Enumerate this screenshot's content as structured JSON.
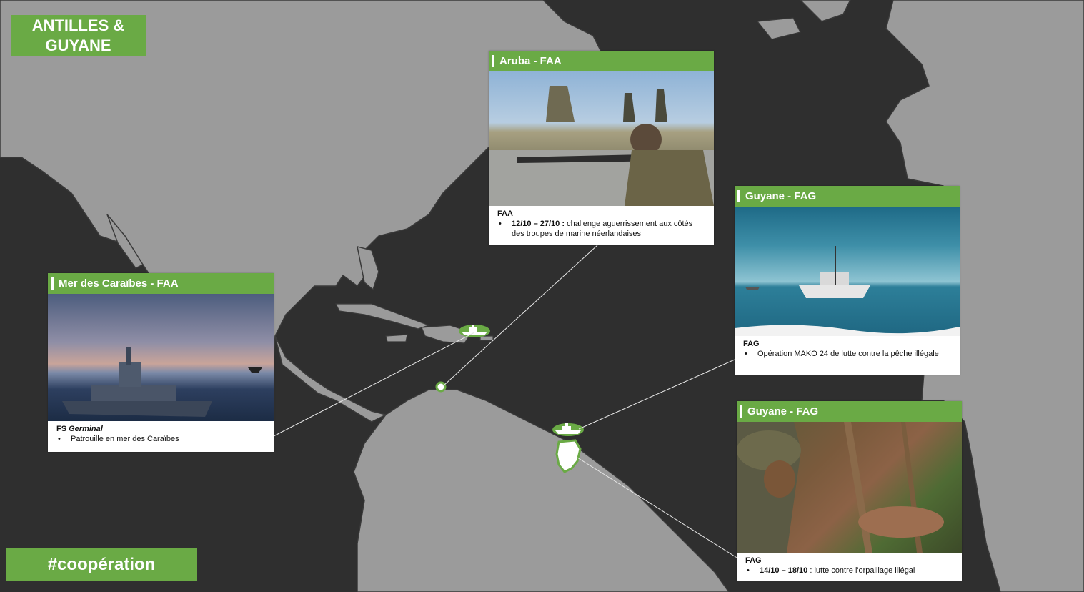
{
  "page": {
    "title_line1": "ANTILLES &",
    "title_line2": "GUYANE",
    "hashtag": "#coopération"
  },
  "colors": {
    "accent": "#6aaa45",
    "ocean": "#2f2f2f",
    "land": "#9b9b9b"
  },
  "markers": [
    {
      "label": "ship-marker-caribbean",
      "icon": "ship-icon"
    },
    {
      "label": "ship-marker-guyane",
      "icon": "ship-icon"
    },
    {
      "label": "region-marker-guyane",
      "icon": "territory-highlight"
    },
    {
      "label": "region-marker-aruba",
      "icon": "territory-highlight"
    }
  ],
  "cards": {
    "caraibes": {
      "header": "Mer des Caraïbes - FAA",
      "unit_prefix": "FS ",
      "unit_name": "Germinal",
      "bullet": "•",
      "text": "Patrouille en mer des Caraïbes",
      "photo": "frigate-with-helicopter-photo"
    },
    "aruba": {
      "header": "Aruba - FAA",
      "org": "FAA",
      "bullet": "•",
      "dates": "12/10 – 27/10 :",
      "text": " challenge aguerrissement aux côtés des troupes de marine néerlandaises",
      "photo": "sniper-training-photo"
    },
    "guyane1": {
      "header": "Guyane - FAG",
      "org": "FAG",
      "bullet": "•",
      "text": "Opération MAKO 24 de lutte contre la pêche illégale",
      "photo": "fishing-boat-photo"
    },
    "guyane2": {
      "header": "Guyane - FAG",
      "org": "FAG",
      "bullet": "•",
      "dates": "14/10 – 18/10",
      "text": " : lutte contre l'orpaillage illégal",
      "photo": "jungle-soldier-photo"
    }
  }
}
